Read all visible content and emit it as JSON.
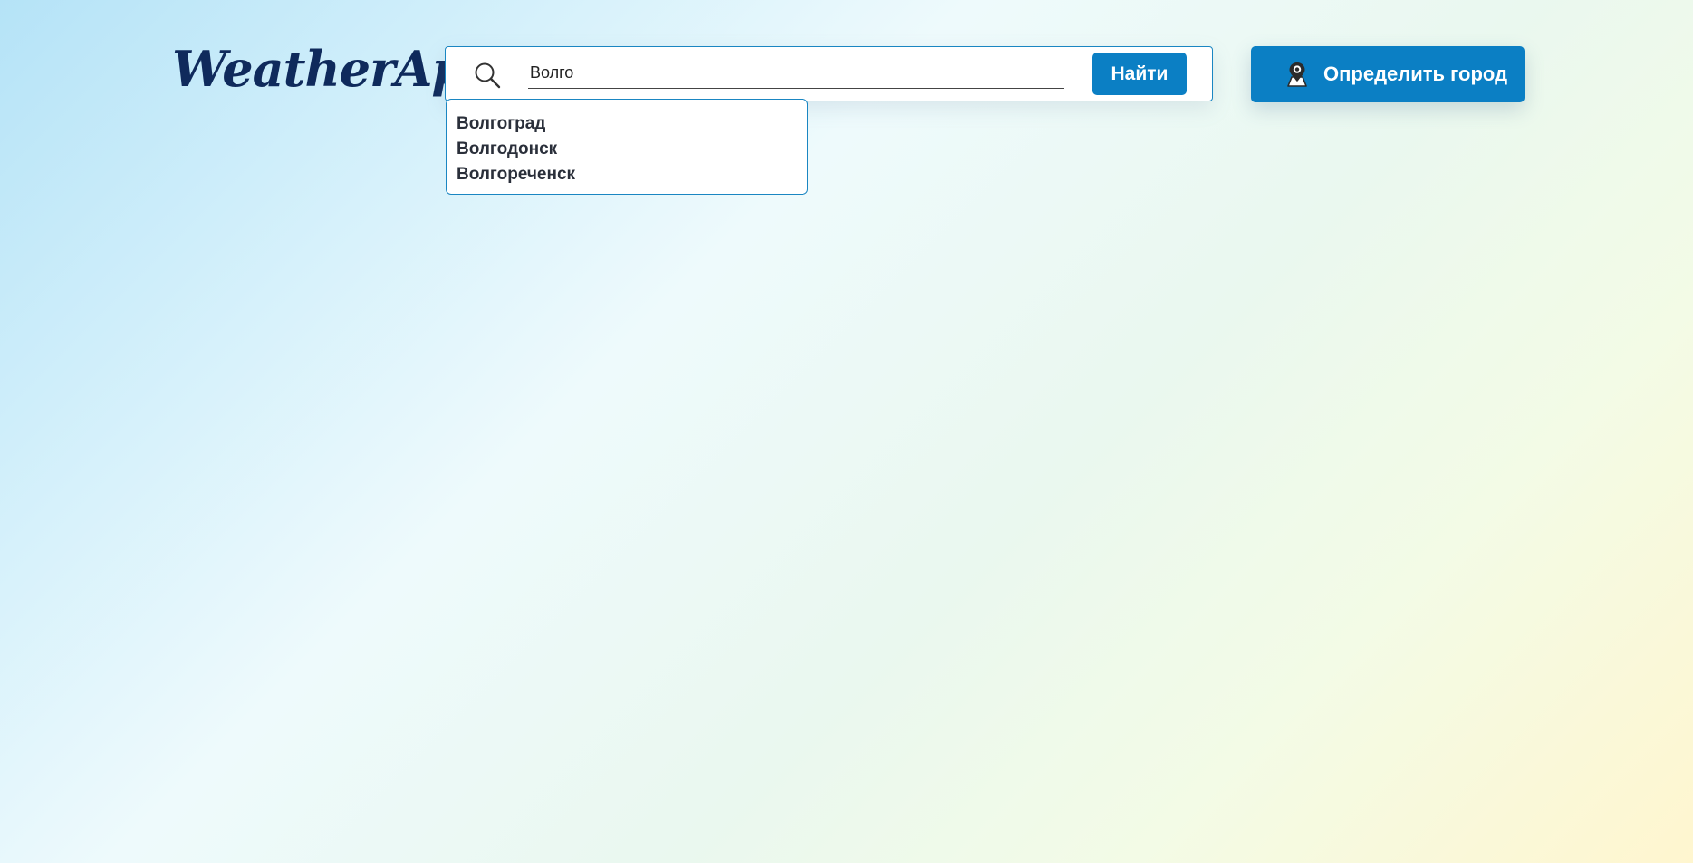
{
  "header": {
    "logo": "WeatherApp",
    "search": {
      "value": "Волго",
      "icon": "search-icon",
      "button_label": "Найти"
    },
    "geo_button": {
      "label": "Определить город",
      "icon": "location-person-icon"
    }
  },
  "suggestions": [
    "Волгоград",
    "Волгодонск",
    "Волгореченск"
  ],
  "colors": {
    "accent": "#0b7fc4",
    "logo": "#0f2a5c",
    "border": "#1a86c2"
  }
}
